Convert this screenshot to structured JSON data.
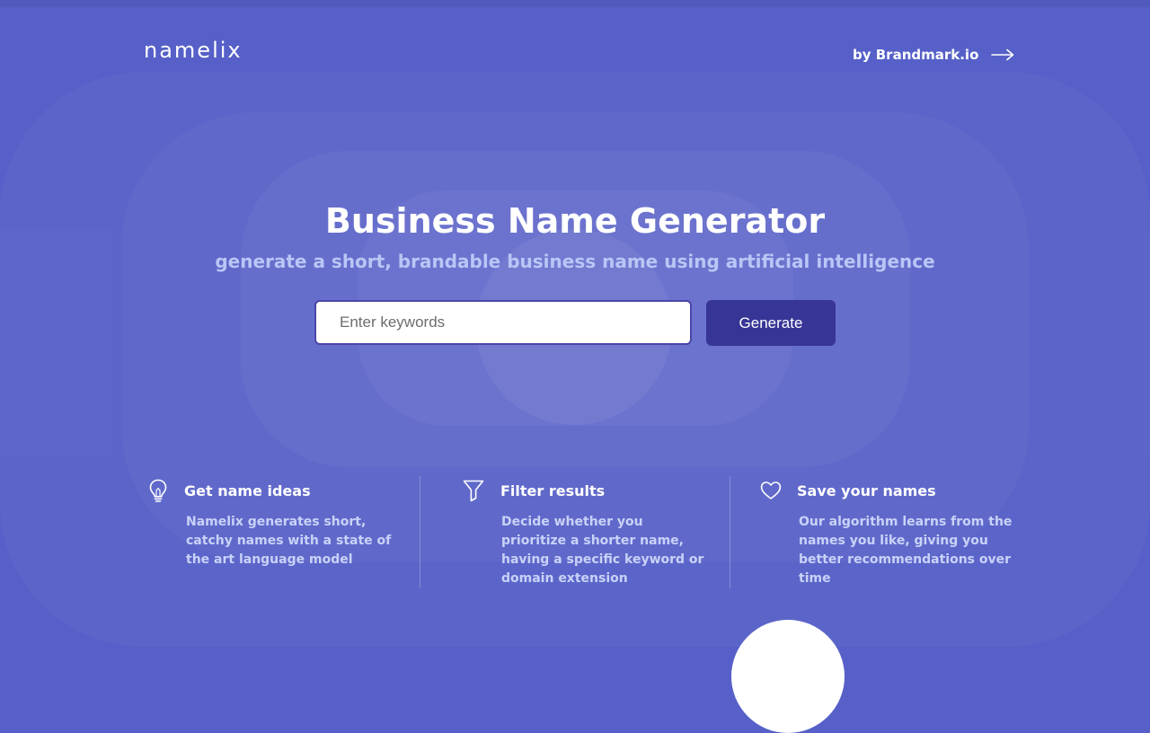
{
  "header": {
    "logo_text": "namelix",
    "brand_link_label": "by Brandmark.io"
  },
  "hero": {
    "title": "Business Name Generator",
    "subtitle": "generate a short, brandable business name using artificial intelligence"
  },
  "search": {
    "placeholder": "Enter keywords",
    "value": "",
    "button_label": "Generate"
  },
  "features": [
    {
      "icon": "lightbulb-icon",
      "title": "Get name ideas",
      "description": "Namelix generates short, catchy names with a state of the art language model"
    },
    {
      "icon": "filter-icon",
      "title": "Filter results",
      "description": "Decide whether you prioritize a shorter name, having a specific keyword or domain extension"
    },
    {
      "icon": "heart-icon",
      "title": "Save your names",
      "description": "Our algorithm learns from the names you like, giving you better recommendations over time"
    }
  ],
  "colors": {
    "background": "#5660c8",
    "button": "#373596",
    "subtitle": "#b9c6f6"
  }
}
